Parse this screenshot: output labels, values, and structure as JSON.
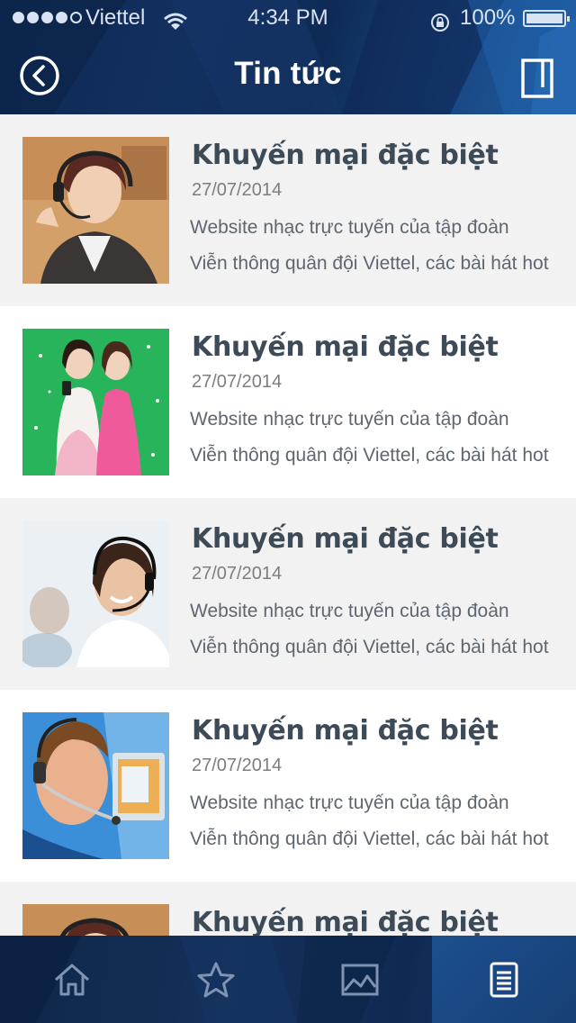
{
  "status_bar": {
    "carrier": "Viettel",
    "time": "4:34 PM",
    "battery": "100%",
    "signal_bars_filled": 4,
    "signal_bars_total": 5
  },
  "nav": {
    "title": "Tin tức",
    "back_icon": "chevron-left-circle-icon",
    "right_icon": "book-icon"
  },
  "news": [
    {
      "title": "Khuyến mại đặc biệt",
      "date": "27/07/2014",
      "line1": "Website nhạc trực tuyến của tập đoàn",
      "line2": "Viễn thông quân đội Viettel, các bài hát hot"
    },
    {
      "title": "Khuyến mại đặc biệt",
      "date": "27/07/2014",
      "line1": "Website nhạc trực tuyến của tập đoàn",
      "line2": "Viễn thông quân đội Viettel, các bài hát hot"
    },
    {
      "title": "Khuyến mại đặc biệt",
      "date": "27/07/2014",
      "line1": "Website nhạc trực tuyến của tập đoàn",
      "line2": "Viễn thông quân đội Viettel, các bài hát hot"
    },
    {
      "title": "Khuyến mại đặc biệt",
      "date": "27/07/2014",
      "line1": "Website nhạc trực tuyến của tập đoàn",
      "line2": "Viễn thông quân đội Viettel, các bài hát hot"
    },
    {
      "title": "Khuyến mại đặc biệt",
      "date": "",
      "line1": "",
      "line2": ""
    }
  ],
  "tabs": [
    {
      "icon": "home-icon",
      "active": false
    },
    {
      "icon": "star-icon",
      "active": false
    },
    {
      "icon": "image-icon",
      "active": false
    },
    {
      "icon": "document-icon",
      "active": true
    }
  ],
  "colors": {
    "header_bg": "#12305f",
    "tab_active": "#1c4f8f",
    "title_text": "#3d4a57"
  }
}
